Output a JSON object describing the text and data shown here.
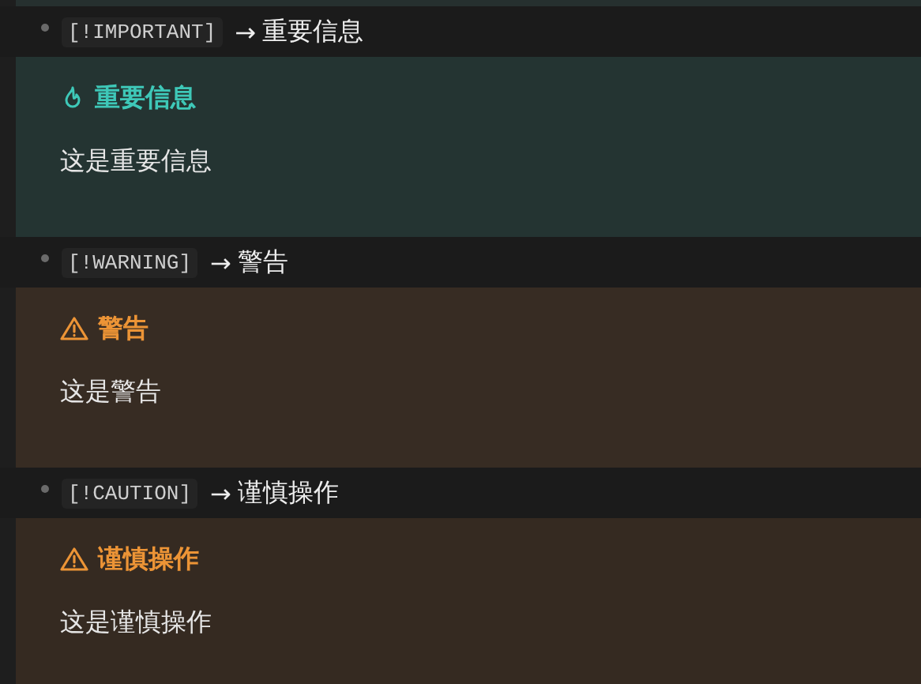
{
  "items": [
    {
      "kind": "important",
      "tag": "[!IMPORTANT]",
      "arrow": "→",
      "label": "重要信息",
      "title": "重要信息",
      "body": "这是重要信息"
    },
    {
      "kind": "warning",
      "tag": "[!WARNING]",
      "arrow": "→",
      "label": "警告",
      "title": "警告",
      "body": "这是警告"
    },
    {
      "kind": "caution",
      "tag": "[!CAUTION]",
      "arrow": "→",
      "label": "谨慎操作",
      "title": "谨慎操作",
      "body": "这是谨慎操作"
    }
  ]
}
